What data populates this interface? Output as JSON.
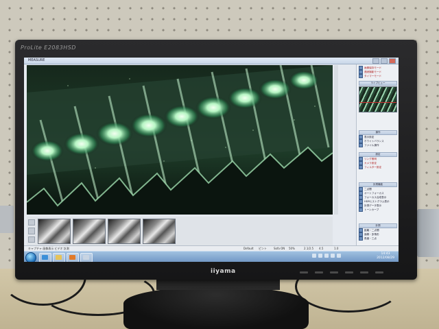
{
  "scene": {
    "monitor_model": "ProLite E2083HSD",
    "monitor_logo": "iiyama"
  },
  "window": {
    "title": "MEASURE"
  },
  "right_panel": {
    "group1_items": [
      {
        "label": "画像保存モード",
        "icon": "save-icon"
      },
      {
        "label": "連続撮影モード",
        "icon": "camera-icon"
      },
      {
        "label": "タイマーモード",
        "icon": "timer-icon"
      }
    ],
    "preview_header": "ライブビュー",
    "group2_header": "操作",
    "group2_items": [
      {
        "label": "表示設定",
        "icon": "display-icon"
      },
      {
        "label": "ホワイトバランス",
        "icon": "palette-icon"
      },
      {
        "label": "ファイル操作",
        "icon": "folder-icon"
      }
    ],
    "group3_header": "設定",
    "group3_items": [
      {
        "label": "リング照明",
        "icon": "light-icon"
      },
      {
        "label": "カメラ設定",
        "icon": "camera-settings-icon"
      },
      {
        "label": "フィルター設定",
        "icon": "filter-icon"
      }
    ],
    "group4_header": "計測機能",
    "group4_items": [
      {
        "label": "二点間",
        "icon": "line-icon"
      },
      {
        "label": "オートフォーカス",
        "icon": "focus-icon"
      },
      {
        "label": "フォーカス合成表示",
        "icon": "layers-icon"
      },
      {
        "label": "HDRヒストグラム表示",
        "icon": "histogram-icon"
      },
      {
        "label": "計測データ表示",
        "icon": "data-icon"
      },
      {
        "label": "トーンカーブ",
        "icon": "curve-icon"
      }
    ],
    "group5_header": "計測",
    "group5_items": [
      {
        "label": "距離・二点間",
        "icon": "ruler-icon"
      },
      {
        "label": "面積・多角形",
        "icon": "polygon-icon"
      },
      {
        "label": "角度・三点",
        "icon": "angle-icon"
      }
    ]
  },
  "status_bar": {
    "left_text": "キャプチャ 画像表示 ビデオ 計測",
    "cells": [
      "Default",
      "ピント",
      "Sofa ON",
      "50%",
      "2.1/2.5",
      "4.5",
      "1.0"
    ]
  },
  "taskbar": {
    "time": "14:43",
    "date": "2012/08/29"
  },
  "thumbnails": {
    "count": 4
  },
  "colors": {
    "specimen_glow": "#d8ffd0",
    "specimen_green": "#2e8a55",
    "panel_red_text": "#b02020"
  }
}
